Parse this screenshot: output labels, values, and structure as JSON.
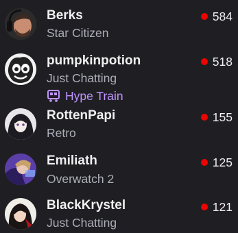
{
  "channels": [
    {
      "name": "Berks",
      "category": "Star Citizen",
      "viewers": "584",
      "avatar": "avatar-berks"
    },
    {
      "name": "pumpkinpotion",
      "category": "Just Chatting",
      "viewers": "518",
      "tag": {
        "label": "Hype Train",
        "icon": "hype-train-icon"
      },
      "avatar": "avatar-pumpkinpotion"
    },
    {
      "name": "RottenPapi",
      "category": "Retro",
      "viewers": "155",
      "avatar": "avatar-rottenpapi"
    },
    {
      "name": "Emiliath",
      "category": "Overwatch 2",
      "viewers": "125",
      "avatar": "avatar-emiliath"
    },
    {
      "name": "BlackKrystel",
      "category": "Just Chatting",
      "viewers": "121",
      "avatar": "avatar-blackkrystel"
    }
  ],
  "colors": {
    "background": "#1f1f23",
    "name": "#efeff1",
    "category": "#adadb8",
    "live_dot": "#eb0400",
    "hype_train": "#bf94ff"
  }
}
